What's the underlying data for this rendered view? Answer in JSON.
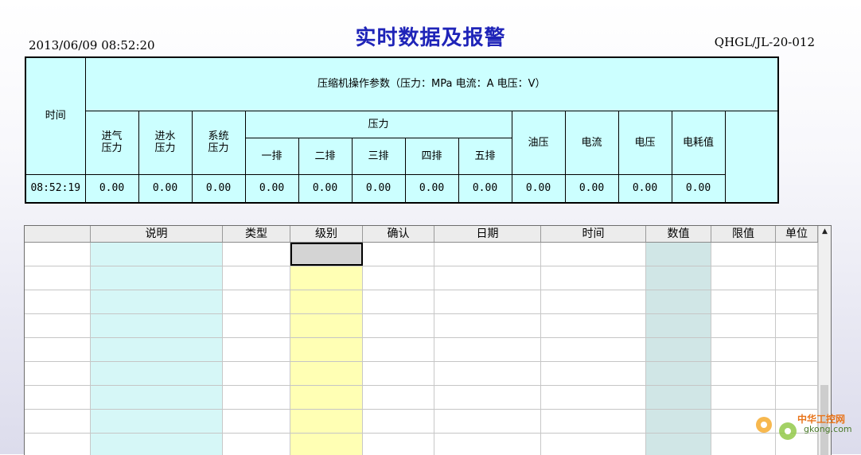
{
  "header": {
    "datetime": "2013/06/09  08:52:20",
    "title": "实时数据及报警",
    "code": "QHGL/JL-20-012"
  },
  "params_table": {
    "time_header": "时间",
    "group_title": "压缩机操作参数（压力：MPa     电流：A    电压：V）",
    "intake_pressure": "进气\n压力",
    "water_pressure": "进水\n压力",
    "system_pressure": "系统\n压力",
    "pressure_group": "压力",
    "rows": [
      "一排",
      "二排",
      "三排",
      "四排",
      "五排"
    ],
    "oil_pressure": "油压",
    "current": "电流",
    "voltage": "电压",
    "energy": "电耗值",
    "data_time": "08:52:19",
    "values": [
      "0.00",
      "0.00",
      "0.00",
      "0.00",
      "0.00",
      "0.00",
      "0.00",
      "0.00",
      "0.00",
      "0.00",
      "0.00",
      "0.00"
    ]
  },
  "alarm_grid": {
    "columns": [
      "",
      "说明",
      "类型",
      "级别",
      "确认",
      "日期",
      "时间",
      "数值",
      "限值",
      "单位"
    ]
  },
  "colors": {
    "title": "#1f24b8",
    "param_bg": "#ccffff",
    "desc_col": "#d6f7f7",
    "level_col": "#ffffb4",
    "value_col": "#d0e6e6"
  },
  "watermark": {
    "brand": "中华工控网",
    "site": "gkong.com"
  }
}
